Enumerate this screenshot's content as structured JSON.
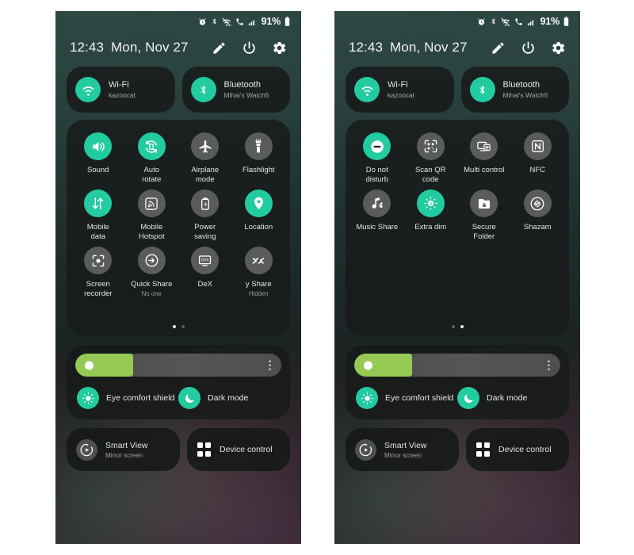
{
  "theme": {
    "accent_teal": "#23cba0",
    "tile_off_gray": "#5a5c5c",
    "slider_green": "#96c954",
    "card_bg": "#1a1c1c"
  },
  "status_bar": {
    "icons": [
      "alarm-icon",
      "bluetooth-icon",
      "wifi-icon",
      "call-mute-icon",
      "signal-bars-icon"
    ],
    "battery_percent": "91%"
  },
  "header": {
    "time": "12:43",
    "date": "Mon, Nov 27",
    "actions": [
      "edit-pencil-icon",
      "power-icon",
      "settings-gear-icon"
    ]
  },
  "connectivity": [
    {
      "name": "wifi",
      "label": "Wi-Fi",
      "sub": "kazoocat",
      "icon": "wifi-icon",
      "on": true
    },
    {
      "name": "bluetooth",
      "label": "Bluetooth",
      "sub": "Mihai's Watch5",
      "icon": "bluetooth-icon",
      "on": true
    }
  ],
  "panels": [
    {
      "id": "page-one",
      "page_index": 0,
      "pages": 2,
      "tiles": [
        {
          "label": "Sound",
          "sub": "",
          "icon": "sound-icon",
          "on": true
        },
        {
          "label": "Auto\nrotate",
          "sub": "",
          "icon": "auto-rotate-icon",
          "on": true
        },
        {
          "label": "Airplane\nmode",
          "sub": "",
          "icon": "airplane-icon",
          "on": false
        },
        {
          "label": "Flashlight",
          "sub": "",
          "icon": "flashlight-icon",
          "on": false
        },
        {
          "label": "Mobile\ndata",
          "sub": "",
          "icon": "mobile-data-icon",
          "on": true
        },
        {
          "label": "Mobile\nHotspot",
          "sub": "",
          "icon": "hotspot-icon",
          "on": false
        },
        {
          "label": "Power\nsaving",
          "sub": "",
          "icon": "power-saving-icon",
          "on": false
        },
        {
          "label": "Location",
          "sub": "",
          "icon": "location-pin-icon",
          "on": true
        },
        {
          "label": "Screen\nrecorder",
          "sub": "",
          "icon": "screen-recorder-icon",
          "on": false
        },
        {
          "label": "Quick Share",
          "sub": "No one",
          "icon": "quick-share-icon",
          "on": false
        },
        {
          "label": "DeX",
          "sub": "",
          "icon": "dex-icon",
          "on": false
        },
        {
          "label": "y Share",
          "sub": "Hidden",
          "icon": "nearby-share-icon",
          "on": false
        }
      ]
    },
    {
      "id": "page-two",
      "page_index": 1,
      "pages": 2,
      "tiles": [
        {
          "label": "Do not\ndisturb",
          "sub": "",
          "icon": "do-not-disturb-icon",
          "on": true
        },
        {
          "label": "Scan QR\ncode",
          "sub": "",
          "icon": "qr-scan-icon",
          "on": false
        },
        {
          "label": "Multi control",
          "sub": "",
          "icon": "multi-control-icon",
          "on": false
        },
        {
          "label": "NFC",
          "sub": "",
          "icon": "nfc-icon",
          "on": false
        },
        {
          "label": "Music Share",
          "sub": "",
          "icon": "music-share-icon",
          "on": false
        },
        {
          "label": "Extra dim",
          "sub": "",
          "icon": "extra-dim-icon",
          "on": true
        },
        {
          "label": "Secure\nFolder",
          "sub": "",
          "icon": "secure-folder-icon",
          "on": false
        },
        {
          "label": "Shazam",
          "sub": "",
          "icon": "shazam-icon",
          "on": false
        }
      ]
    }
  ],
  "brightness": {
    "value_percent": 28,
    "knob_icon": "brightness-sun-icon",
    "menu_icon": "more-vertical-icon"
  },
  "display_modes": [
    {
      "label": "Eye comfort shield",
      "icon": "eye-comfort-icon",
      "on": true
    },
    {
      "label": "Dark mode",
      "icon": "moon-icon",
      "on": true
    }
  ],
  "bottom_tiles": [
    {
      "label": "Smart View",
      "sub": "Mirror screen",
      "icon": "smart-view-icon"
    },
    {
      "label": "Device control",
      "sub": "",
      "icon": "device-control-icon"
    }
  ]
}
